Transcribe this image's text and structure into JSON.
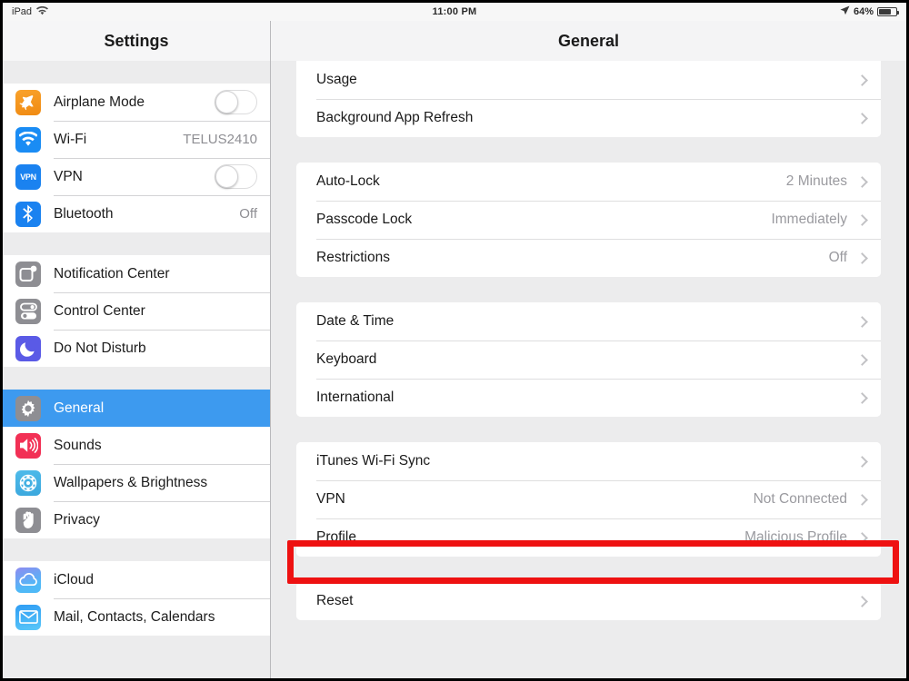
{
  "status_bar": {
    "device_label": "iPad",
    "wifi_icon": "wifi-icon",
    "time": "11:00 PM",
    "location_icon": "location-arrow-icon",
    "battery_percent": "64%",
    "battery_level": 64
  },
  "nav": {
    "sidebar_title": "Settings",
    "detail_title": "General"
  },
  "colors": {
    "selection_blue": "#3d9aef",
    "highlight_red": "#ee1111",
    "value_gray": "#9a9a9f",
    "pane_background": "#ececed"
  },
  "sidebar": {
    "groups": [
      {
        "items": [
          {
            "label": "Airplane Mode",
            "icon": "airplane-icon",
            "icon_color": "#f79520",
            "control": "toggle",
            "toggle_on": false,
            "value": ""
          },
          {
            "label": "Wi-Fi",
            "icon": "wifi-icon",
            "icon_color": "#1a8cf4",
            "control": "value",
            "value": "TELUS2410"
          },
          {
            "label": "VPN",
            "icon": "vpn-icon",
            "icon_color": "#1a82f0",
            "control": "toggle",
            "toggle_on": false,
            "value": ""
          },
          {
            "label": "Bluetooth",
            "icon": "bluetooth-icon",
            "icon_color": "#1a82f0",
            "control": "value",
            "value": "Off"
          }
        ]
      },
      {
        "items": [
          {
            "label": "Notification Center",
            "icon": "notification-center-icon",
            "icon_color": "#8e8e93",
            "control": "none",
            "value": ""
          },
          {
            "label": "Control Center",
            "icon": "control-center-icon",
            "icon_color": "#8e8e93",
            "control": "none",
            "value": ""
          },
          {
            "label": "Do Not Disturb",
            "icon": "do-not-disturb-moon-icon",
            "icon_color": "#5a5ae6",
            "control": "none",
            "value": ""
          }
        ]
      },
      {
        "items": [
          {
            "label": "General",
            "icon": "gear-icon",
            "icon_color": "#8e8e93",
            "control": "none",
            "value": "",
            "selected": true
          },
          {
            "label": "Sounds",
            "icon": "speaker-icon",
            "icon_color": "#f23055",
            "control": "none",
            "value": ""
          },
          {
            "label": "Wallpapers & Brightness",
            "icon": "wallpaper-flower-icon",
            "icon_color": "#45b7e8",
            "control": "none",
            "value": ""
          },
          {
            "label": "Privacy",
            "icon": "hand-icon",
            "icon_color": "#8e8e93",
            "control": "none",
            "value": ""
          }
        ]
      },
      {
        "items": [
          {
            "label": "iCloud",
            "icon": "icloud-icon",
            "icon_color": "#5aa8f5",
            "control": "none",
            "value": ""
          },
          {
            "label": "Mail, Contacts, Calendars",
            "icon": "mail-icon",
            "icon_color": "#2f9df4",
            "control": "none",
            "value": ""
          }
        ]
      }
    ]
  },
  "detail": {
    "groups": [
      {
        "clipped_top": true,
        "rows": [
          {
            "label": "Usage",
            "value": "",
            "chevron": true
          },
          {
            "label": "Background App Refresh",
            "value": "",
            "chevron": true
          }
        ]
      },
      {
        "rows": [
          {
            "label": "Auto-Lock",
            "value": "2 Minutes",
            "chevron": true
          },
          {
            "label": "Passcode Lock",
            "value": "Immediately",
            "chevron": true
          },
          {
            "label": "Restrictions",
            "value": "Off",
            "chevron": true
          }
        ]
      },
      {
        "rows": [
          {
            "label": "Date & Time",
            "value": "",
            "chevron": true
          },
          {
            "label": "Keyboard",
            "value": "",
            "chevron": true
          },
          {
            "label": "International",
            "value": "",
            "chevron": true
          }
        ]
      },
      {
        "rows": [
          {
            "label": "iTunes Wi-Fi Sync",
            "value": "",
            "chevron": true
          },
          {
            "label": "VPN",
            "value": "Not Connected",
            "chevron": true
          },
          {
            "label": "Profile",
            "value": "Malicious Profile",
            "chevron": true,
            "highlighted": true
          }
        ]
      },
      {
        "rows": [
          {
            "label": "Reset",
            "value": "",
            "chevron": true
          }
        ]
      }
    ]
  },
  "annotation": {
    "highlight_target": "Profile",
    "shape": "rectangle",
    "color": "#ee1111"
  }
}
